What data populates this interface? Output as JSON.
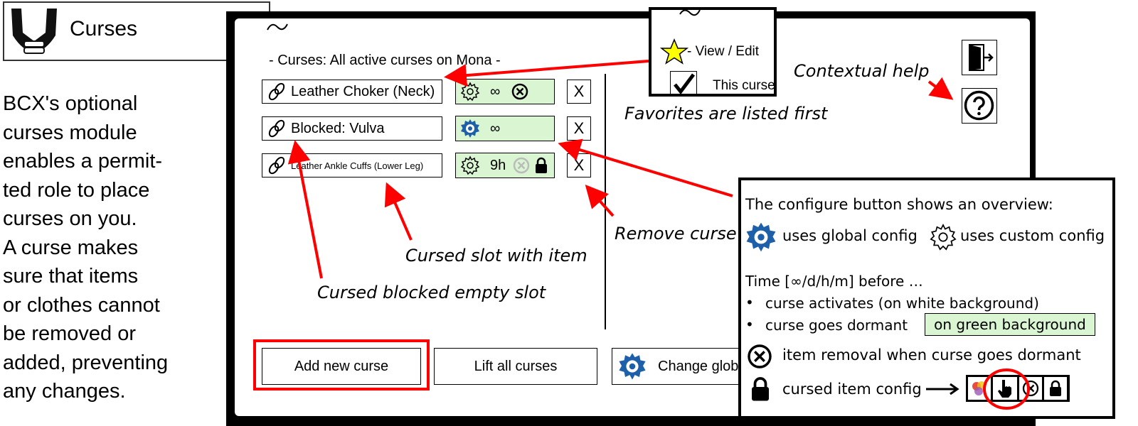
{
  "header": {
    "title": "Curses"
  },
  "intro": {
    "lines": [
      "BCX's optional",
      "curses module",
      "enables a permit-",
      "ted role to place",
      "curses on you.",
      "A curse makes",
      "sure that items",
      "or clothes cannot",
      "be removed or",
      "added, preventing",
      "any changes."
    ]
  },
  "panel": {
    "heading": "- Curses: All active curses on Mona -",
    "curses": [
      {
        "label": "Leather Choker (Neck)",
        "config": "custom",
        "time": "∞",
        "removal_icon": true,
        "locked": false,
        "remove_label": "X"
      },
      {
        "label": "Blocked: Vulva",
        "config": "global",
        "time": "∞",
        "removal_icon": false,
        "locked": false,
        "remove_label": "X"
      },
      {
        "label": "Leather Ankle Cuffs (Lower Leg)",
        "config": "custom",
        "time": "9h",
        "removal_icon": true,
        "removal_faded": true,
        "locked": true,
        "remove_label": "X"
      }
    ],
    "buttons": {
      "add": "Add new curse",
      "lift": "Lift all curses",
      "global": "Change glob"
    }
  },
  "favorites_popup": {
    "view_edit": "- View / Edit",
    "this_curse": "This curse"
  },
  "annotations": {
    "favorites": "Favorites are listed first",
    "help": "Contextual help",
    "remove": "Remove curse",
    "slot_item": "Cursed slot with item",
    "blocked": "Cursed blocked empty slot"
  },
  "overview": {
    "title": "The configure button shows an overview:",
    "global": "uses global config",
    "custom": "uses custom config",
    "time_before": "Time [∞/d/h/m] before …",
    "bullet1": "curse activates (on white background)",
    "bullet2": "curse goes dormant",
    "green_label": "on green background",
    "removal": "item removal when curse goes dormant",
    "cursed_config": "cursed item config"
  },
  "colors": {
    "accent_red": "#ff0000",
    "green_bg": "#d9f5d2",
    "gear_blue": "#1d5fa8"
  }
}
